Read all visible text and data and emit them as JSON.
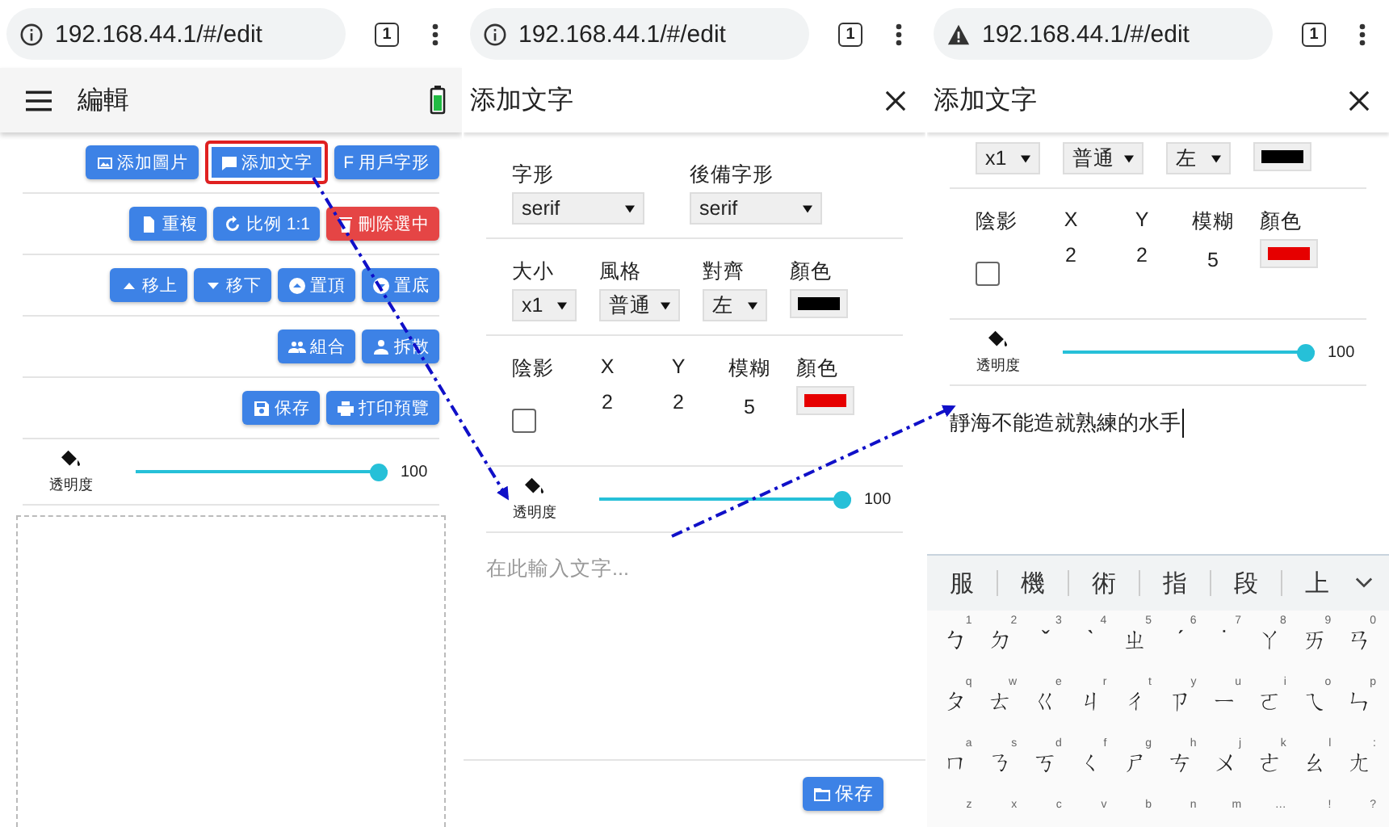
{
  "panels": [
    {
      "kind": "editor",
      "browser": {
        "url": "192.168.44.1/#/edit",
        "tab_count": "1"
      },
      "app_bar": {
        "title": "編輯"
      },
      "toolbar_rows": [
        [
          {
            "label": "添加圖片",
            "highlighted": false
          },
          {
            "label": "添加文字",
            "highlighted": true
          },
          {
            "label": "F 用戶字形",
            "highlighted": false
          }
        ],
        [
          {
            "label": "重複",
            "highlighted": false
          },
          {
            "label": "比例 1:1",
            "highlighted": false
          },
          {
            "label": "刪除選中",
            "highlighted": false
          }
        ],
        [
          {
            "label": "移上",
            "highlighted": false
          },
          {
            "label": "移下",
            "highlighted": false
          },
          {
            "label": "置頂",
            "highlighted": false
          },
          {
            "label": "置底",
            "highlighted": false
          }
        ],
        [
          {
            "label": "組合",
            "highlighted": false
          },
          {
            "label": "拆散",
            "highlighted": false
          }
        ],
        [
          {
            "label": "保存",
            "highlighted": false
          },
          {
            "label": "打印預覽",
            "highlighted": false
          }
        ]
      ],
      "opacity": {
        "label": "透明度",
        "level": 1,
        "reading": "100"
      }
    },
    {
      "kind": "dialog",
      "browser": {
        "url": "192.168.44.1/#/edit",
        "tab_count": "1"
      },
      "title": "添加文字",
      "font": [
        {
          "kind": "select",
          "label": "字形",
          "value": "serif"
        },
        {
          "kind": "select",
          "label": "後備字形",
          "value": "serif"
        }
      ],
      "style": [
        {
          "kind": "select",
          "label": "大小",
          "value": "x1"
        },
        {
          "kind": "select",
          "label": "風格",
          "value": "普通"
        },
        {
          "kind": "select",
          "label": "對齊",
          "value": "左"
        },
        {
          "kind": "color",
          "label": "顏色",
          "color": "#000000"
        }
      ],
      "shadow": [
        {
          "kind": "checkbox",
          "label": "陰影",
          "checked": false
        },
        {
          "kind": "number",
          "label": "X",
          "value": "2"
        },
        {
          "kind": "number",
          "label": "Y",
          "value": "2"
        },
        {
          "kind": "number",
          "label": "模糊",
          "value": "5"
        },
        {
          "kind": "color",
          "label": "顏色",
          "color": "#e60000"
        }
      ],
      "opacity": {
        "label": "透明度",
        "level": 1,
        "reading": "100"
      },
      "text_input": {
        "placeholder": "在此輸入文字..."
      },
      "save_button": {
        "label": "保存"
      }
    },
    {
      "kind": "dialog",
      "browser": {
        "url": "192.168.44.1/#/edit",
        "tab_count": "1"
      },
      "title": "添加文字",
      "style": [
        {
          "kind": "select",
          "value": "x1"
        },
        {
          "kind": "select",
          "value": "普通"
        },
        {
          "kind": "select",
          "value": "左"
        },
        {
          "kind": "color",
          "color": "#000000"
        }
      ],
      "shadow": [
        {
          "kind": "checkbox",
          "label": "陰影",
          "checked": false
        },
        {
          "kind": "number",
          "label": "X",
          "value": "2"
        },
        {
          "kind": "number",
          "label": "Y",
          "value": "2"
        },
        {
          "kind": "number",
          "label": "模糊",
          "value": "5"
        },
        {
          "kind": "color",
          "label": "顏色",
          "color": "#e60000"
        }
      ],
      "opacity": {
        "label": "透明度",
        "level": 1,
        "reading": "100"
      },
      "text_input": {
        "value": "靜海不能造就熟練的水手"
      },
      "keyboard": {
        "candidates": [
          "服",
          "機",
          "術",
          "指",
          "段",
          "上"
        ],
        "rows": [
          [
            {
              "hint": "1",
              "char": "ㄅ"
            },
            {
              "hint": "2",
              "char": "ㄉ"
            },
            {
              "hint": "3",
              "char": "ˇ"
            },
            {
              "hint": "4",
              "char": "ˋ"
            },
            {
              "hint": "5",
              "char": "ㄓ"
            },
            {
              "hint": "6",
              "char": "ˊ"
            },
            {
              "hint": "7",
              "char": "˙"
            },
            {
              "hint": "8",
              "char": "ㄚ"
            },
            {
              "hint": "9",
              "char": "ㄞ"
            },
            {
              "hint": "0",
              "char": "ㄢ"
            }
          ],
          [
            {
              "hint": "q",
              "char": "ㄆ"
            },
            {
              "hint": "w",
              "char": "ㄊ"
            },
            {
              "hint": "e",
              "char": "ㄍ"
            },
            {
              "hint": "r",
              "char": "ㄐ"
            },
            {
              "hint": "t",
              "char": "ㄔ"
            },
            {
              "hint": "y",
              "char": "ㄗ"
            },
            {
              "hint": "u",
              "char": "ㄧ"
            },
            {
              "hint": "i",
              "char": "ㄛ"
            },
            {
              "hint": "o",
              "char": "ㄟ"
            },
            {
              "hint": "p",
              "char": "ㄣ"
            }
          ],
          [
            {
              "hint": "a",
              "char": "ㄇ"
            },
            {
              "hint": "s",
              "char": "ㄋ"
            },
            {
              "hint": "d",
              "char": "ㄎ"
            },
            {
              "hint": "f",
              "char": "ㄑ"
            },
            {
              "hint": "g",
              "char": "ㄕ"
            },
            {
              "hint": "h",
              "char": "ㄘ"
            },
            {
              "hint": "j",
              "char": "ㄨ"
            },
            {
              "hint": "k",
              "char": "ㄜ"
            },
            {
              "hint": "l",
              "char": "ㄠ"
            },
            {
              "hint": ":",
              "char": "ㄤ"
            }
          ],
          [
            {
              "hint": "z"
            },
            {
              "hint": "x"
            },
            {
              "hint": "c"
            },
            {
              "hint": "v"
            },
            {
              "hint": "b"
            },
            {
              "hint": "n"
            },
            {
              "hint": "m"
            },
            {
              "hint": "…"
            },
            {
              "hint": "!"
            },
            {
              "hint": "?"
            }
          ]
        ]
      }
    }
  ]
}
